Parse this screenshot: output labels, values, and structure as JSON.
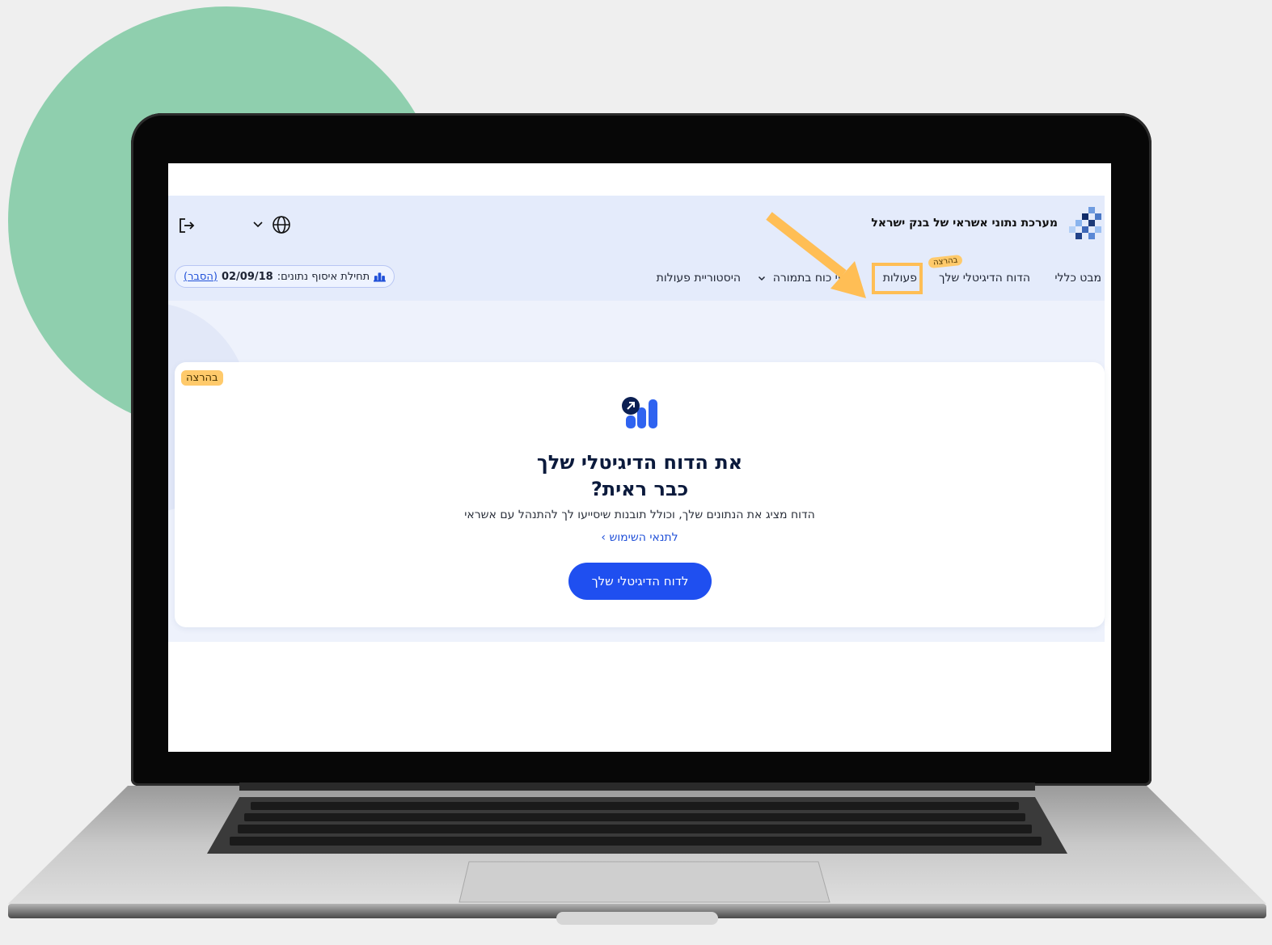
{
  "app": {
    "title": "מערכת נתוני אשראי של בנק ישראל",
    "icons": {
      "logo": "bank-of-israel-logo",
      "language": "globe-icon",
      "logout": "logout-icon"
    }
  },
  "nav": {
    "items": [
      {
        "label": "מבט כללי"
      },
      {
        "label": "הדוח הדיגיטלי שלך",
        "badge": "בהרצה"
      },
      {
        "label": "פעולות",
        "highlighted": true
      },
      {
        "label": "מיופי כוח בתמורה",
        "has_dropdown": true
      },
      {
        "label": "היסטוריית פעולות"
      }
    ]
  },
  "data_collection": {
    "label": "תחילת איסוף נתונים:",
    "date": "02/09/18",
    "explain_link": "(הסבר)"
  },
  "card": {
    "badge": "בהרצה",
    "title_line1": "את הדוח הדיגיטלי שלך",
    "title_line2": "כבר ראית?",
    "description": "הדוח מציג את הנתונים שלך, וכולל תובנות שיסייעו לך להתנהל עם אשראי",
    "terms_link": "לתנאי השימוש ›",
    "cta_label": "לדוח הדיגיטלי שלך"
  },
  "colors": {
    "accent": "#1f4ff0",
    "badge": "#ffca6b",
    "highlight": "#ffbe55",
    "header_bg": "#e4ebfb",
    "decor_circle": "#8fcfae"
  }
}
